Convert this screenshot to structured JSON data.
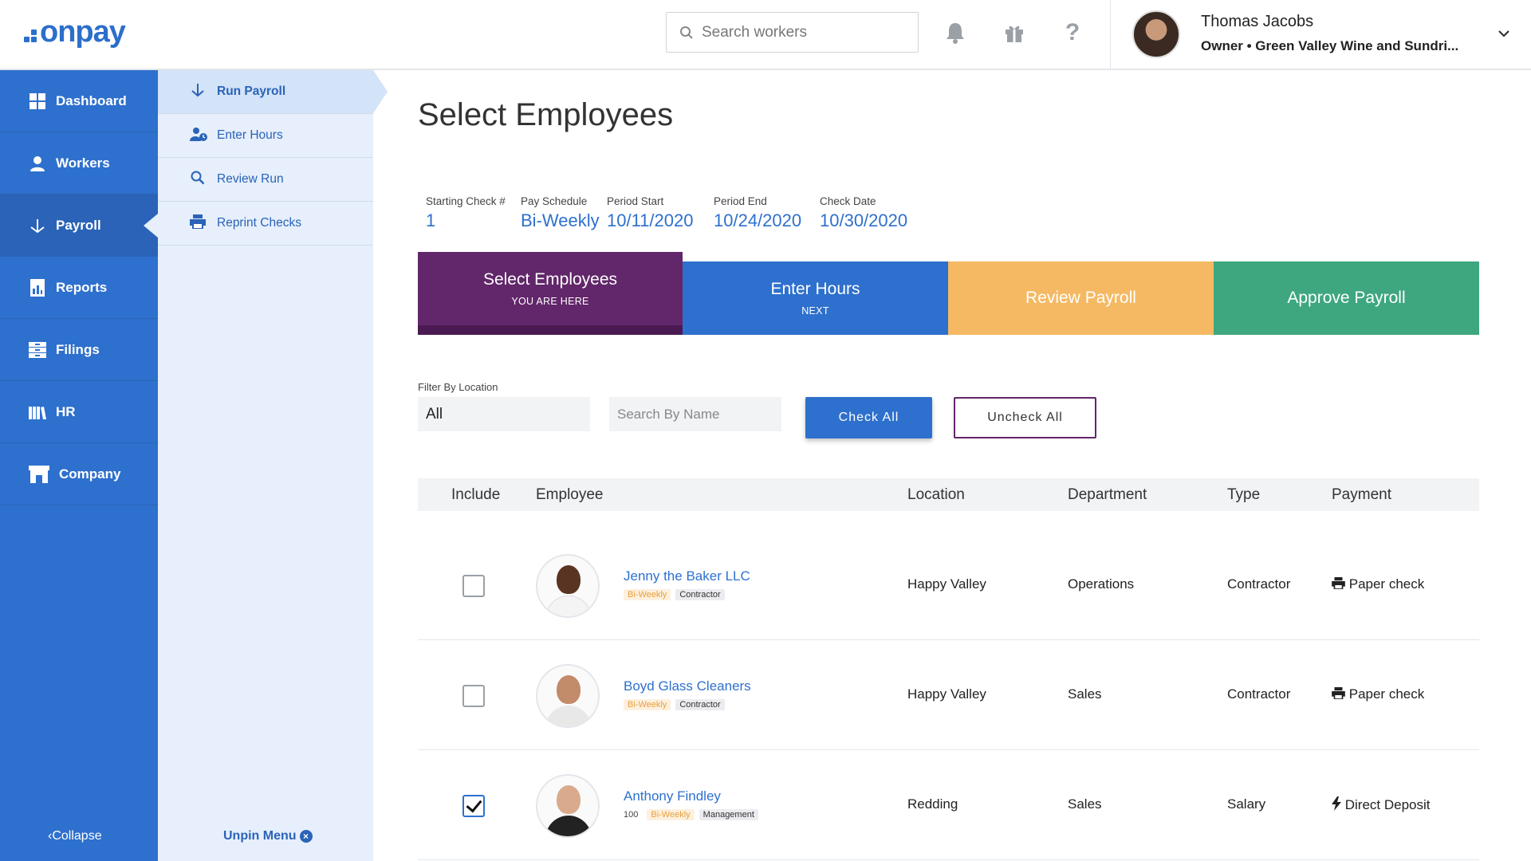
{
  "brand": {
    "logo_text": "onpay",
    "accent": "#2e70cd"
  },
  "header": {
    "search_placeholder": "Search workers",
    "user_name": "Thomas Jacobs",
    "user_role": "Owner • Green Valley Wine and Sundri..."
  },
  "sidebar": {
    "items": [
      {
        "label": "Dashboard",
        "icon": "dashboard-icon"
      },
      {
        "label": "Workers",
        "icon": "workers-icon"
      },
      {
        "label": "Payroll",
        "icon": "payroll-icon"
      },
      {
        "label": "Reports",
        "icon": "reports-icon"
      },
      {
        "label": "Filings",
        "icon": "filings-icon"
      },
      {
        "label": "HR",
        "icon": "hr-icon"
      },
      {
        "label": "Company",
        "icon": "company-icon"
      }
    ],
    "active": "Payroll",
    "collapse_label": "Collapse"
  },
  "submenu": {
    "items": [
      {
        "label": "Run Payroll"
      },
      {
        "label": "Enter Hours"
      },
      {
        "label": "Review Run"
      },
      {
        "label": "Reprint Checks"
      }
    ],
    "active": "Run Payroll",
    "unpin_label": "Unpin Menu"
  },
  "main": {
    "title": "Select Employees",
    "meta": [
      {
        "label": "Starting Check #",
        "value": "1"
      },
      {
        "label": "Pay Schedule",
        "value": "Bi-Weekly"
      },
      {
        "label": "Period Start",
        "value": "10/11/2020"
      },
      {
        "label": "Period End",
        "value": "10/24/2020"
      },
      {
        "label": "Check Date",
        "value": "10/30/2020"
      }
    ],
    "steps": [
      {
        "title": "Select Employees",
        "sub": "YOU ARE HERE",
        "color": "#62266a"
      },
      {
        "title": "Enter Hours",
        "sub": "NEXT",
        "color": "#2e70cd"
      },
      {
        "title": "Review Payroll",
        "sub": "",
        "color": "#f5b963"
      },
      {
        "title": "Approve Payroll",
        "sub": "",
        "color": "#3ea780"
      }
    ],
    "filter": {
      "label": "Filter By Location",
      "value": "All",
      "name_placeholder": "Search By Name",
      "check_all": "Check All",
      "uncheck_all": "Uncheck All"
    },
    "table": {
      "columns": [
        "Include",
        "Employee",
        "Location",
        "Department",
        "Type",
        "Payment"
      ],
      "rows": [
        {
          "name": "Jenny the Baker LLC",
          "num": "",
          "schedule": "Bi-Weekly",
          "kind": "Contractor",
          "location": "Happy Valley",
          "department": "Operations",
          "type": "Contractor",
          "payment": "Paper check",
          "payment_icon": "printer-icon",
          "included": false
        },
        {
          "name": "Boyd Glass Cleaners",
          "num": "",
          "schedule": "Bi-Weekly",
          "kind": "Contractor",
          "location": "Happy Valley",
          "department": "Sales",
          "type": "Contractor",
          "payment": "Paper check",
          "payment_icon": "printer-icon",
          "included": false
        },
        {
          "name": "Anthony Findley",
          "num": "100",
          "schedule": "Bi-Weekly",
          "kind": "Management",
          "location": "Redding",
          "department": "Sales",
          "type": "Salary",
          "payment": "Direct Deposit",
          "payment_icon": "lightning-icon",
          "included": true
        }
      ]
    }
  }
}
